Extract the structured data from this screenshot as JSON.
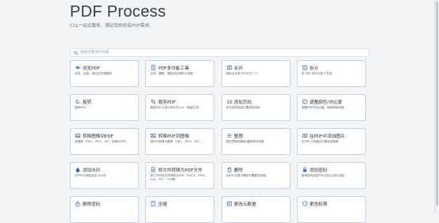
{
  "header": {
    "title": "PDF Process",
    "subtitle": "C2L一站式服务，满足您的所有PDF需求。"
  },
  "search": {
    "placeholder": "搜索您需要的功能..."
  },
  "tools": [
    {
      "title": "浏览PDF",
      "desc": "浏览、目插、添加文本或图像",
      "icon": "eye-icon"
    },
    {
      "title": "PDF多功能工具",
      "desc": "合并、翻转、删除或对调PDF页面",
      "icon": "document-tools-icon"
    },
    {
      "title": "合并",
      "desc": "轻松合并多个PDF为一个。",
      "icon": "merge-icon"
    },
    {
      "title": "拆分",
      "desc": "将 PDF 拆分为多个文档。",
      "icon": "split-icon"
    },
    {
      "title": "旋转",
      "desc": "旋转PDF。",
      "icon": "rotate-icon"
    },
    {
      "title": "裁剪PDF",
      "desc": "裁剪PDF以减小其文件大小（保留文本）",
      "icon": "crop-icon"
    },
    {
      "title": "添加页码",
      "desc": "在文档的指定位置添加页码",
      "icon": "page-number-icon"
    },
    {
      "title": "调整颜色/对比度",
      "desc": "调整PDF的对比度、饱和度和亮度",
      "icon": "palette-icon"
    },
    {
      "title": "转换图像到PDF",
      "desc": "将图像（PNG、JPEG、GIF）转换为PDF。",
      "icon": "image-to-pdf-icon"
    },
    {
      "title": "转换PDF到图像",
      "desc": "将PDF转换为图像（PNG、JPEG、GIF）。",
      "icon": "pdf-to-image-icon"
    },
    {
      "title": "整理",
      "desc": "按任意顺序删除/重新排列页面",
      "icon": "organize-icon"
    },
    {
      "title": "在PDF中添加图片",
      "desc": "在PDF上的指定位置添加图像",
      "icon": "add-image-icon"
    },
    {
      "title": "添加水印",
      "desc": "在PDF中添加自定义水印。",
      "icon": "watermark-icon"
    },
    {
      "title": "将文件转换为PDF文件",
      "desc": "将几乎所有文件转换为PDF（DOCX、PNG、XLS、PPT、TXT等）",
      "icon": "file-convert-icon"
    },
    {
      "title": "删除",
      "desc": "从PDF文档中删除不需要的页面。",
      "icon": "delete-icon"
    },
    {
      "title": "添加密码",
      "desc": "使用密码加密PDF文档以进行加密。",
      "icon": "lock-icon"
    },
    {
      "title": "删除密码",
      "desc": "",
      "icon": "unlock-icon"
    },
    {
      "title": "压缩",
      "desc": "",
      "icon": "compress-icon"
    },
    {
      "title": "更改元数据",
      "desc": "",
      "icon": "metadata-icon"
    },
    {
      "title": "更改权限",
      "desc": "",
      "icon": "shield-icon"
    }
  ],
  "colors": {
    "accent": "#2e6db4",
    "card_border": "#c7d4df",
    "background": "#f2f4f6"
  }
}
